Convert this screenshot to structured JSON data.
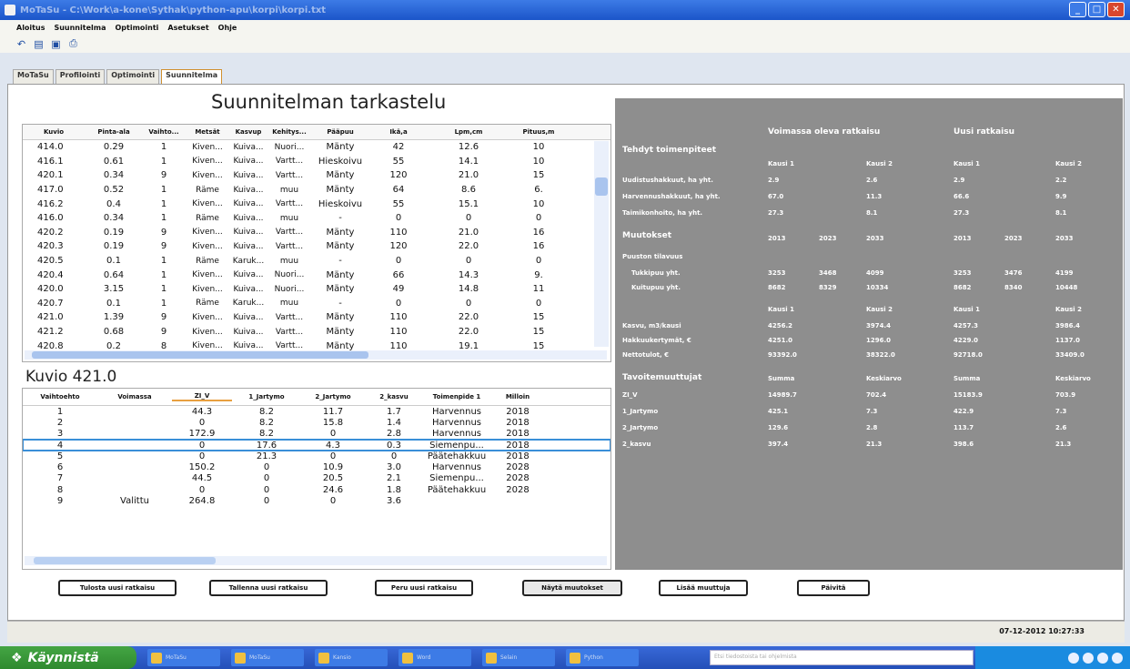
{
  "window": {
    "title": "MoTaSu - C:\\Work\\a-kone\\Sythak\\python-apu\\korpi\\korpi.txt"
  },
  "menu": [
    "Aloitus",
    "Suunnitelma",
    "Optimointi",
    "Asetukset",
    "Ohje"
  ],
  "toolbar_icons": [
    "back-icon",
    "open-icon",
    "save-icon",
    "print-icon"
  ],
  "tabs": [
    {
      "label": "MoTaSu"
    },
    {
      "label": "Profilointi"
    },
    {
      "label": "Optimointi"
    },
    {
      "label": "Suunnitelma"
    }
  ],
  "main_title": "Suunnitelman tarkastelu",
  "plan_table": {
    "headers": [
      "Kuvio",
      "Pinta-ala",
      "Vaihto...",
      "Metsät",
      "Kasvup",
      "Kehitys...",
      "Pääpuu",
      "Ikä,a",
      "Lpm,cm",
      "Pituus,m"
    ],
    "rows": [
      [
        "414.0",
        "0.29",
        "1",
        "Kiven...",
        "Kuiva...",
        "Nuori...",
        "Mänty",
        "42",
        "12.6",
        "10"
      ],
      [
        "416.1",
        "0.61",
        "1",
        "Kiven...",
        "Kuiva...",
        "Vartt...",
        "Hieskoivu",
        "55",
        "14.1",
        "10"
      ],
      [
        "420.1",
        "0.34",
        "9",
        "Kiven...",
        "Kuiva...",
        "Vartt...",
        "Mänty",
        "120",
        "21.0",
        "15"
      ],
      [
        "417.0",
        "0.52",
        "1",
        "Räme",
        "Kuiva...",
        "muu",
        "Mänty",
        "64",
        "8.6",
        "6."
      ],
      [
        "416.2",
        "0.4",
        "1",
        "Kiven...",
        "Kuiva...",
        "Vartt...",
        "Hieskoivu",
        "55",
        "15.1",
        "10"
      ],
      [
        "416.0",
        "0.34",
        "1",
        "Räme",
        "Kuiva...",
        "muu",
        "-",
        "0",
        "0",
        "0"
      ],
      [
        "420.2",
        "0.19",
        "9",
        "Kiven...",
        "Kuiva...",
        "Vartt...",
        "Mänty",
        "110",
        "21.0",
        "16"
      ],
      [
        "420.3",
        "0.19",
        "9",
        "Kiven...",
        "Kuiva...",
        "Vartt...",
        "Mänty",
        "120",
        "22.0",
        "16"
      ],
      [
        "420.5",
        "0.1",
        "1",
        "Räme",
        "Karuk...",
        "muu",
        "-",
        "0",
        "0",
        "0"
      ],
      [
        "420.4",
        "0.64",
        "1",
        "Kiven...",
        "Kuiva...",
        "Nuori...",
        "Mänty",
        "66",
        "14.3",
        "9."
      ],
      [
        "420.0",
        "3.15",
        "1",
        "Kiven...",
        "Kuiva...",
        "Nuori...",
        "Mänty",
        "49",
        "14.8",
        "11"
      ],
      [
        "420.7",
        "0.1",
        "1",
        "Räme",
        "Karuk...",
        "muu",
        "-",
        "0",
        "0",
        "0"
      ],
      [
        "421.0",
        "1.39",
        "9",
        "Kiven...",
        "Kuiva...",
        "Vartt...",
        "Mänty",
        "110",
        "22.0",
        "15"
      ],
      [
        "421.2",
        "0.68",
        "9",
        "Kiven...",
        "Kuiva...",
        "Vartt...",
        "Mänty",
        "110",
        "22.0",
        "15"
      ],
      [
        "420.8",
        "0.2",
        "8",
        "Kiven...",
        "Kuiva...",
        "Vartt...",
        "Mänty",
        "110",
        "19.1",
        "15"
      ]
    ]
  },
  "kuvio_title": "Kuvio 421.0",
  "alt_table": {
    "headers": [
      "Vaihtoehto",
      "Voimassa",
      "ZI_V",
      "1_Jartymo",
      "2_Jartymo",
      "2_kasvu",
      "Toimenpide 1",
      "Milloin"
    ],
    "rows": [
      [
        "1",
        "",
        "44.3",
        "8.2",
        "11.7",
        "1.7",
        "Harvennus",
        "2018"
      ],
      [
        "2",
        "",
        "0",
        "8.2",
        "15.8",
        "1.4",
        "Harvennus",
        "2018"
      ],
      [
        "3",
        "",
        "172.9",
        "8.2",
        "0",
        "2.8",
        "Harvennus",
        "2018"
      ],
      [
        "4",
        "",
        "0",
        "17.6",
        "4.3",
        "0.3",
        "Siemenpu...",
        "2018"
      ],
      [
        "5",
        "",
        "0",
        "21.3",
        "0",
        "0",
        "Päätehakkuu",
        "2018"
      ],
      [
        "6",
        "",
        "150.2",
        "0",
        "10.9",
        "3.0",
        "Harvennus",
        "2028"
      ],
      [
        "7",
        "",
        "44.5",
        "0",
        "20.5",
        "2.1",
        "Siemenpu...",
        "2028"
      ],
      [
        "8",
        "",
        "0",
        "0",
        "24.6",
        "1.8",
        "Päätehakkuu",
        "2028"
      ],
      [
        "9",
        "Valittu",
        "264.8",
        "0",
        "0",
        "3.6",
        "",
        ""
      ]
    ]
  },
  "buttons": {
    "tulosta": "Tulosta uusi ratkaisu",
    "tallenna": "Tallenna uusi ratkaisu",
    "peru": "Peru uusi ratkaisu",
    "nayta": "Näytä muutokset",
    "lisaa": "Lisää muuttuja",
    "paivita": "Päivitä"
  },
  "summary": {
    "col_current": "Voimassa oleva ratkaisu",
    "col_new": "Uusi ratkaisu",
    "tehdyt": "Tehdyt toimenpiteet",
    "kausi1": "Kausi 1",
    "kausi2": "Kausi 2",
    "r1_label": "Uudistushakkuut, ha yht.",
    "r1": [
      "2.9",
      "2.6",
      "2.9",
      "2.2"
    ],
    "r2_label": "Harvennushakkuut, ha yht.",
    "r2": [
      "67.0",
      "11.3",
      "66.6",
      "9.9"
    ],
    "r3_label": "Taimikonhoito, ha yht.",
    "r3": [
      "27.3",
      "8.1",
      "27.3",
      "8.1"
    ],
    "muutokset": "Muutokset",
    "years": [
      "2013",
      "2023",
      "2033",
      "2013",
      "2023",
      "2033"
    ],
    "puuston": "Puuston tilavuus",
    "tukkipuu_label": "Tukkipuu yht.",
    "tukkipuu": [
      "3253",
      "3468",
      "4099",
      "3253",
      "3476",
      "4199"
    ],
    "kuitupuu_label": "Kuitupuu yht.",
    "kuitupuu": [
      "8682",
      "8329",
      "10334",
      "8682",
      "8340",
      "10448"
    ],
    "kasvu_label": "Kasvu, m3/kausi",
    "kasvu": [
      "4256.2",
      "3974.4",
      "4257.3",
      "3986.4"
    ],
    "hakk_label": "Hakkuukertymät, €",
    "hakk": [
      "4251.0",
      "1296.0",
      "4229.0",
      "1137.0"
    ],
    "netto_label": "Nettotulot, €",
    "netto": [
      "93392.0",
      "38322.0",
      "92718.0",
      "33409.0"
    ],
    "tavoite": "Tavoitemuuttujat",
    "summa": "Summa",
    "keskiarvo": "Keskiarvo",
    "zi_label": "ZI_V",
    "zi": [
      "14989.7",
      "702.4",
      "15183.9",
      "703.9"
    ],
    "j1_label": "1_Jartymo",
    "j1": [
      "425.1",
      "7.3",
      "422.9",
      "7.3"
    ],
    "j2_label": "2_Jartymo",
    "j2": [
      "129.6",
      "2.8",
      "113.7",
      "2.6"
    ],
    "k2_label": "2_kasvu",
    "k2": [
      "397.4",
      "21.3",
      "398.6",
      "21.3"
    ]
  },
  "status": {
    "timestamp": "07-12-2012 10:27:33"
  },
  "taskbar": {
    "start_label": "Käynnistä",
    "items": [
      "MoTaSu",
      "MoTaSu",
      "Kansio",
      "Word",
      "Selain",
      "Python"
    ],
    "search_placeholder": "Etsi tiedostoista tai ohjelmista"
  }
}
